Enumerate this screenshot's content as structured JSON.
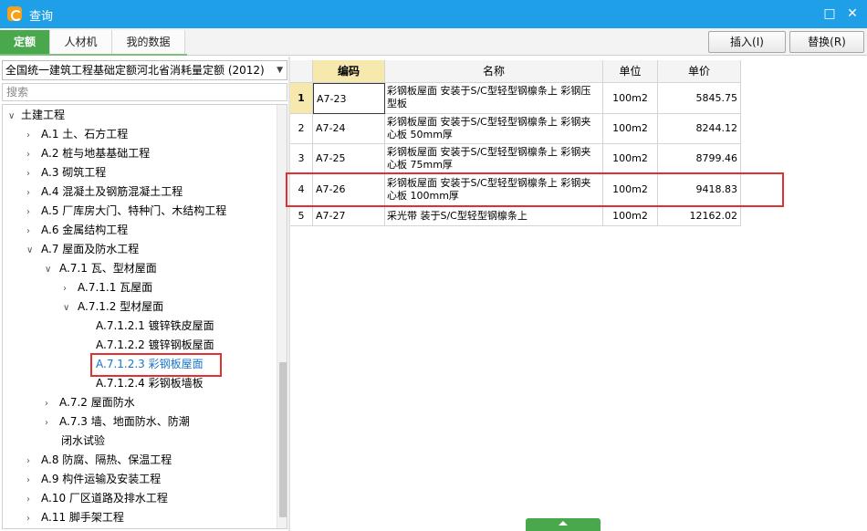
{
  "window": {
    "title": "查询"
  },
  "tabs": [
    {
      "label": "定额",
      "active": true
    },
    {
      "label": "人材机",
      "active": false
    },
    {
      "label": "我的数据",
      "active": false
    }
  ],
  "toolbar": {
    "insert_label": "插入(I)",
    "replace_label": "替换(R)"
  },
  "library": {
    "selected": "全国统一建筑工程基础定额河北省消耗量定额 (2012)"
  },
  "search": {
    "placeholder": "搜索"
  },
  "tree": {
    "items": [
      {
        "label": "土建工程",
        "state": "expanded"
      },
      {
        "label": "A.1 土、石方工程",
        "state": "collapsed"
      },
      {
        "label": "A.2 桩与地基基础工程",
        "state": "collapsed"
      },
      {
        "label": "A.3 砌筑工程",
        "state": "collapsed"
      },
      {
        "label": "A.4 混凝土及钢筋混凝土工程",
        "state": "collapsed"
      },
      {
        "label": "A.5 厂库房大门、特种门、木结构工程",
        "state": "collapsed"
      },
      {
        "label": "A.6 金属结构工程",
        "state": "collapsed"
      },
      {
        "label": "A.7 屋面及防水工程",
        "state": "expanded"
      },
      {
        "label": "A.7.1 瓦、型材屋面",
        "state": "expanded"
      },
      {
        "label": "A.7.1.1 瓦屋面",
        "state": "collapsed"
      },
      {
        "label": "A.7.1.2 型材屋面",
        "state": "expanded"
      },
      {
        "label": "A.7.1.2.1 镀锌铁皮屋面",
        "state": "leaf"
      },
      {
        "label": "A.7.1.2.2 镀锌钢板屋面",
        "state": "leaf"
      },
      {
        "label": "A.7.1.2.3 彩钢板屋面",
        "state": "leaf",
        "selected": true
      },
      {
        "label": "A.7.1.2.4 彩钢板墙板",
        "state": "leaf"
      },
      {
        "label": "A.7.2 屋面防水",
        "state": "collapsed"
      },
      {
        "label": "A.7.3 墙、地面防水、防潮",
        "state": "collapsed"
      },
      {
        "label": "闭水试验",
        "state": "continuation"
      },
      {
        "label": "A.8 防腐、隔热、保温工程",
        "state": "collapsed"
      },
      {
        "label": "A.9 构件运输及安装工程",
        "state": "collapsed"
      },
      {
        "label": "A.10 厂区道路及排水工程",
        "state": "collapsed"
      },
      {
        "label": "A.11 脚手架工程",
        "state": "collapsed"
      }
    ]
  },
  "table": {
    "columns": [
      "编码",
      "名称",
      "单位",
      "单价"
    ],
    "rows": [
      {
        "num": "1",
        "code": "A7-23",
        "name": "彩钢板屋面 安装于S/C型轻型钢檩条上 彩钢压型板",
        "unit": "100m2",
        "price": "5845.75"
      },
      {
        "num": "2",
        "code": "A7-24",
        "name": "彩钢板屋面 安装于S/C型轻型钢檩条上 彩钢夹心板 50mm厚",
        "unit": "100m2",
        "price": "8244.12"
      },
      {
        "num": "3",
        "code": "A7-25",
        "name": "彩钢板屋面 安装于S/C型轻型钢檩条上 彩钢夹心板 75mm厚",
        "unit": "100m2",
        "price": "8799.46"
      },
      {
        "num": "4",
        "code": "A7-26",
        "name": "彩钢板屋面 安装于S/C型轻型钢檩条上 彩钢夹心板 100mm厚",
        "unit": "100m2",
        "price": "9418.83"
      },
      {
        "num": "5",
        "code": "A7-27",
        "name": "采光带 装于S/C型轻型钢檩条上",
        "unit": "100m2",
        "price": "12162.02"
      }
    ]
  },
  "colors": {
    "titlebar": "#1f9fe8",
    "active_tab": "#49a84c",
    "highlight_box": "#e03030",
    "selected_link": "#1a75c9",
    "current_row": "#f7e9ad"
  }
}
